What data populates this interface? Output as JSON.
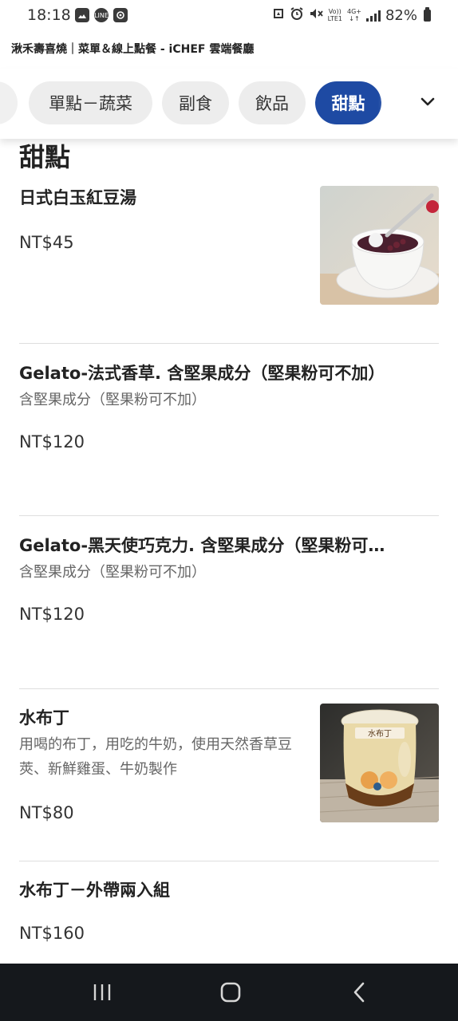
{
  "status_bar": {
    "time": "18:18",
    "left_icons": [
      "gallery-icon",
      "line-app-icon",
      "media-icon"
    ],
    "right_icons": [
      "recycle-icon",
      "alarm-icon",
      "mute-icon"
    ],
    "volte_top": "Vo))",
    "volte_bottom": "LTE1",
    "network_label": "4G+",
    "battery": "82%"
  },
  "page": {
    "title": "湫禾壽喜燒｜菜單＆線上點餐 - iCHEF 雲端餐廳"
  },
  "category_tabs": [
    {
      "label": "單點－蔬菜",
      "active": false
    },
    {
      "label": "副食",
      "active": false
    },
    {
      "label": "飲品",
      "active": false
    },
    {
      "label": "甜點",
      "active": true
    }
  ],
  "colors": {
    "accent": "#1e4aa3",
    "tab_bg": "#ededed",
    "nav_bar": "#15181c"
  },
  "section": {
    "heading": "甜點"
  },
  "items": [
    {
      "name": "日式白玉紅豆湯",
      "description": "",
      "price": "NT$45",
      "image": "red-bean-soup-photo"
    },
    {
      "name": "Gelato-法式香草. 含堅果成分（堅果粉可不加）",
      "description": "含堅果成分（堅果粉可不加）",
      "price": "NT$120",
      "image": ""
    },
    {
      "name": "Gelato-黑天使巧克力. 含堅果成分（堅果粉可…",
      "description": "含堅果成分（堅果粉可不加）",
      "price": "NT$120",
      "image": ""
    },
    {
      "name": "水布丁",
      "description": "用喝的布丁，用吃的牛奶，使用天然香草豆莢、新鮮雞蛋、牛奶製作",
      "price": "NT$80",
      "image": "pudding-jar-photo"
    },
    {
      "name": "水布丁－外帶兩入組",
      "description": "",
      "price": "NT$160",
      "image": ""
    }
  ],
  "pudding_label": {
    "brand": "水布丁"
  },
  "nav_bar": {
    "buttons": [
      "recent-apps-icon",
      "home-icon",
      "back-icon"
    ]
  }
}
